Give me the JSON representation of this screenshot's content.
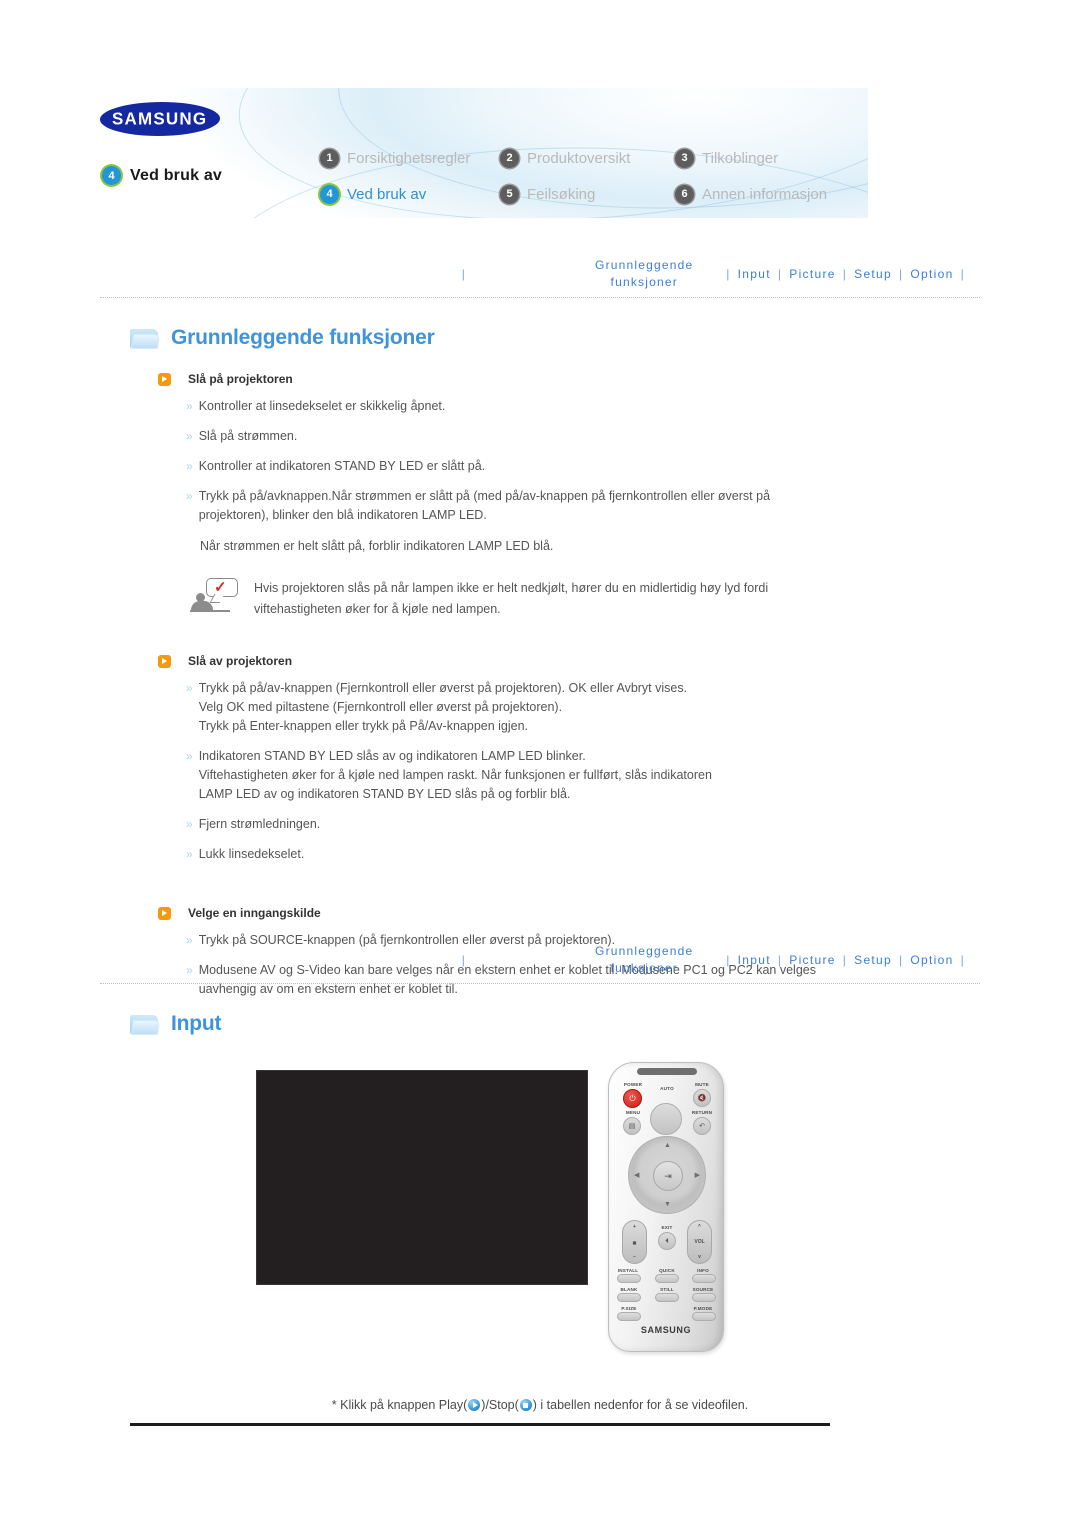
{
  "brand": "SAMSUNG",
  "header": {
    "current_chapter": {
      "number": "4",
      "label": "Ved bruk av"
    },
    "tabs": [
      {
        "number": "1",
        "label": "Forsiktighetsregler",
        "active": false
      },
      {
        "number": "2",
        "label": "Produktoversikt",
        "active": false
      },
      {
        "number": "3",
        "label": "Tilkoblinger",
        "active": false
      },
      {
        "number": "4",
        "label": "Ved bruk av",
        "active": true
      },
      {
        "number": "5",
        "label": "Feilsøking",
        "active": false
      },
      {
        "number": "6",
        "label": "Annen informasjon",
        "active": false
      }
    ]
  },
  "subnav": {
    "main_line1": "Grunnleggende",
    "main_line2": "funksjoner",
    "links": [
      "Input",
      "Picture",
      "Setup",
      "Option"
    ],
    "separator": "|"
  },
  "section_basic": {
    "title": "Grunnleggende funksjoner",
    "groups": [
      {
        "heading": "Slå på projektoren",
        "items": [
          "Kontroller at linsedekselet er skikkelig åpnet.",
          "Slå på strømmen.",
          "Kontroller at indikatoren STAND BY LED er slått på.",
          "Trykk på på/avknappen.Når strømmen er slått på (med på/av-knappen på fjernkontrollen eller øverst på\nprojektoren), blinker den blå indikatoren LAMP LED."
        ],
        "plain": "Når strømmen er helt slått på, forblir indikatoren LAMP LED blå.",
        "note": "Hvis projektoren slås på når lampen ikke er helt nedkjølt, hører du en midlertidig høy lyd fordi\nviftehastigheten øker for å kjøle ned lampen."
      },
      {
        "heading": "Slå av projektoren",
        "items": [
          "Trykk på på/av-knappen (Fjernkontroll eller øverst på projektoren). OK eller Avbryt vises.\nVelg OK med piltastene (Fjernkontroll eller øverst på projektoren).\nTrykk på Enter-knappen eller trykk på På/Av-knappen igjen.",
          "Indikatoren STAND BY LED slås av og indikatoren LAMP LED blinker.\nViftehastigheten øker for å kjøle ned lampen raskt. Når funksjonen er fullført, slås indikatoren\nLAMP LED av og indikatoren STAND BY LED slås på og forblir blå.",
          "Fjern strømledningen.",
          "Lukk linsedekselet."
        ]
      },
      {
        "heading": "Velge en inngangskilde",
        "items": [
          "Trykk på SOURCE-knappen (på fjernkontrollen eller øverst på projektoren).",
          "Modusene AV og S-Video kan bare velges når en ekstern enhet er koblet til. Modusene PC1 og PC2 kan velges\nuavhengig av om en ekstern enhet er koblet til."
        ]
      }
    ]
  },
  "section_input": {
    "title": "Input",
    "caption_prefix": "* Klikk på knappen Play(",
    "caption_mid": ")/Stop(",
    "caption_suffix": ") i tabellen nedenfor for å se videofilen."
  },
  "remote": {
    "brand": "SAMSUNG",
    "labels": {
      "power": "POWER",
      "auto": "AUTO",
      "mute": "MUTE",
      "menu": "MENU",
      "return": "RETURN",
      "exit": "EXIT",
      "vol": "VOL",
      "install": "INSTALL",
      "quick": "QUICK",
      "info": "INFO",
      "blank": "BLANK",
      "still": "STILL",
      "source": "SOURCE",
      "psize": "P.SIZE",
      "pmode": "P.MODE"
    }
  }
}
